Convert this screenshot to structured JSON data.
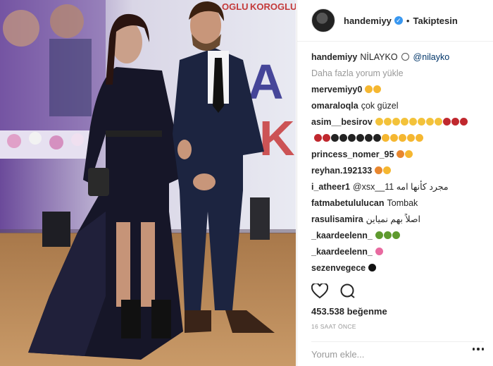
{
  "photo": {
    "backdrop_text_left": "OGLU",
    "backdrop_text_right": "KOROGLU",
    "backdrop_letters": "AL AK"
  },
  "header": {
    "username": "handemiyy",
    "verified_icon": "verified-badge-icon",
    "follow_label": "Takiptesin"
  },
  "caption": {
    "username": "handemiyy",
    "text": "NİLAYKO",
    "emoji": "alarm-clock-emoji",
    "mention": "@nilayko"
  },
  "load_more": "Daha fazla yorum yükle",
  "comments": [
    {
      "user": "mervemiyy0",
      "text": "",
      "emojis": [
        "#f5b731",
        "#f5b731"
      ]
    },
    {
      "user": "omaraloqla",
      "text": "çok güzel",
      "emojis": []
    },
    {
      "user": "asim__besirov",
      "text": "",
      "emojis": [
        "#f3c23a",
        "#f3c23a",
        "#f3c23a",
        "#f3c23a",
        "#f3c23a",
        "#f3c23a",
        "#f3c23a",
        "#f3c23a",
        "#c0282e",
        "#c0282e",
        "#c0282e"
      ]
    },
    {
      "user": "",
      "text": "",
      "emojis": [
        "#c0282e",
        "#c0282e",
        "#222222",
        "#222222",
        "#222222",
        "#222222",
        "#222222",
        "#222222",
        "#f5b731",
        "#f5b731",
        "#f5b731",
        "#f5b731",
        "#f5b731"
      ]
    },
    {
      "user": "princess_nomer_95",
      "text": "",
      "emojis": [
        "#e8862e",
        "#f5b731"
      ]
    },
    {
      "user": "reyhan.192133",
      "text": "",
      "emojis": [
        "#e8862e",
        "#f5b731"
      ]
    },
    {
      "user": "i_atheer1",
      "text": "@xsx__11 مجرد كأنها امه",
      "emojis": []
    },
    {
      "user": "fatmabetululucan",
      "text": "Tombak",
      "emojis": []
    },
    {
      "user": "rasulisamira",
      "text": "اصلاً بهم نمیاین",
      "emojis": []
    },
    {
      "user": "_kaardeelenn_",
      "text": "",
      "emojis": [
        "#5e9a2e",
        "#5e9a2e",
        "#5e9a2e"
      ]
    },
    {
      "user": "_kaardeelenn_",
      "text": "",
      "emojis": [
        "#e86aa0"
      ]
    },
    {
      "user": "sezenvegece",
      "text": "",
      "emojis": [
        "#111111"
      ]
    },
    {
      "user": "sezenvegece",
      "text": "",
      "emojis": [
        "#d2283a"
      ]
    },
    {
      "user": "sezenvegece",
      "text": "",
      "emojis": [
        "#8a6ad1"
      ]
    }
  ],
  "actions": {
    "like_icon": "heart-icon",
    "comment_icon": "comment-bubble-icon"
  },
  "likes": "453.538 beğenme",
  "time": "16 SAAT ÖNCE",
  "add_comment": {
    "placeholder": "Yorum ekle..."
  },
  "colors": {
    "verified": "#3897f0",
    "text": "#262626",
    "muted": "#999999",
    "mention": "#003569"
  }
}
